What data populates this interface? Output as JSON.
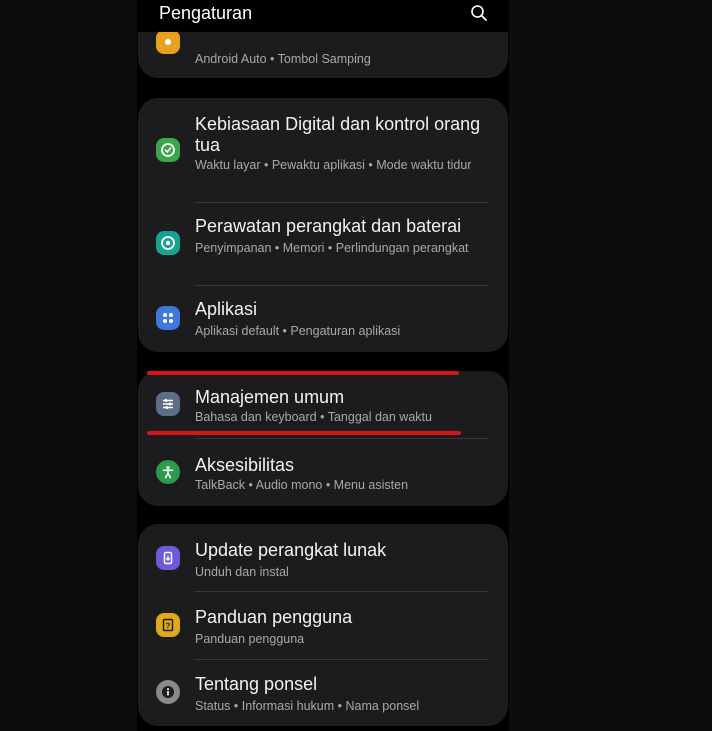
{
  "header": {
    "title": "Pengaturan",
    "search_icon": "search-icon"
  },
  "groups": [
    {
      "items": [
        {
          "title": "",
          "subtitle": "Android Auto  •  Tombol Samping",
          "icon": "gear-icon",
          "icon_color": "#e8a020"
        }
      ]
    },
    {
      "items": [
        {
          "title": "Kebiasaan Digital dan kontrol orang tua",
          "subtitle": "Waktu layar  •  Pewaktu aplikasi  •  Mode waktu tidur",
          "icon": "digital-wellbeing-icon",
          "icon_color": "#3aa64a"
        },
        {
          "title": "Perawatan perangkat dan baterai",
          "subtitle": "Penyimpanan  •  Memori  •  Perlindungan perangkat",
          "icon": "device-care-icon",
          "icon_color": "#17a38f"
        },
        {
          "title": "Aplikasi",
          "subtitle": "Aplikasi default  •  Pengaturan aplikasi",
          "icon": "apps-icon",
          "icon_color": "#3f78d8"
        }
      ]
    },
    {
      "items": [
        {
          "title": "Manajemen umum",
          "subtitle": "Bahasa dan keyboard  •  Tanggal dan waktu",
          "icon": "sliders-icon",
          "icon_color": "#5e6e86"
        },
        {
          "title": "Aksesibilitas",
          "subtitle": "TalkBack  •  Audio mono  •  Menu asisten",
          "icon": "accessibility-icon",
          "icon_color": "#2f9a4a"
        }
      ]
    },
    {
      "items": [
        {
          "title": "Update perangkat lunak",
          "subtitle": "Unduh dan instal",
          "icon": "software-update-icon",
          "icon_color": "#6b5bd6"
        },
        {
          "title": "Panduan pengguna",
          "subtitle": "Panduan pengguna",
          "icon": "user-manual-icon",
          "icon_color": "#e0a81c"
        },
        {
          "title": "Tentang ponsel",
          "subtitle": "Status  •  Informasi hukum  •  Nama ponsel",
          "icon": "info-icon",
          "icon_color": "#8a8a8a"
        }
      ]
    }
  ],
  "annotation_color": "#d8141b"
}
